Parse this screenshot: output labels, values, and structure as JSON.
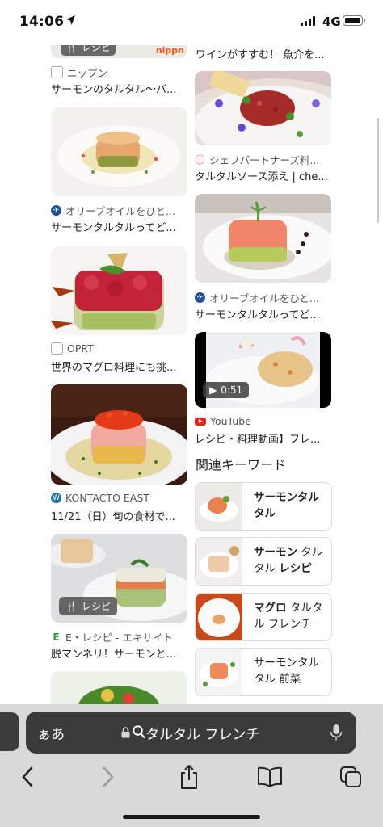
{
  "status_bar": {
    "time": "14:06",
    "network": "4G"
  },
  "left_column": [
    {
      "source": "ニップン",
      "title": "サーモンのタルタル～バ...",
      "badge": "レシピ",
      "brand": "nippn"
    },
    {
      "source": "オリーブオイルをひと...",
      "title": "サーモンタルタルってど..."
    },
    {
      "source": "OPRT",
      "title": "世界のマグロ料理にも挑..."
    },
    {
      "source": "KONTACTO EAST",
      "title": "11/21（日）旬の食材で..."
    },
    {
      "source": "E・レシピ - エキサイト",
      "title": "脱マンネリ！サーモンと...",
      "badge": "レシピ"
    }
  ],
  "right_column": [
    {
      "title": "ワインがすすむ！ 魚介を..."
    },
    {
      "source": "シェフパートナーズ料...",
      "title": "タルタルソース添え | che..."
    },
    {
      "source": "オリーブオイルをひと...",
      "title": "サーモンタルタルってど..."
    },
    {
      "source": "YouTube",
      "title": "レシピ・料理動画】フレ...",
      "duration": "0:51"
    }
  ],
  "related": {
    "heading": "関連キーワード",
    "items": [
      {
        "bold": "サーモンタルタル",
        "normal": ""
      },
      {
        "bold": "サーモン",
        "normal": " タルタル ",
        "bold2": "レシピ"
      },
      {
        "bold": "マグロ",
        "normal": " タルタル フレンチ"
      },
      {
        "bold": "",
        "normal": "サーモンタルタル 前菜"
      }
    ]
  },
  "address_bar": {
    "aa_label": "ぁあ",
    "query": "タルタル フレンチ"
  },
  "icons": [
    "location-arrow-icon",
    "signal-icon",
    "battery-icon",
    "lock-icon",
    "search-icon",
    "mic-icon",
    "back-icon",
    "forward-icon",
    "share-icon",
    "bookmarks-icon",
    "tabs-icon",
    "play-icon",
    "fork-knife-icon"
  ],
  "colors": {
    "youtube_red": "#e62117",
    "ui_bar": "#d9d9d9",
    "url_field": "#3b3b3b"
  }
}
